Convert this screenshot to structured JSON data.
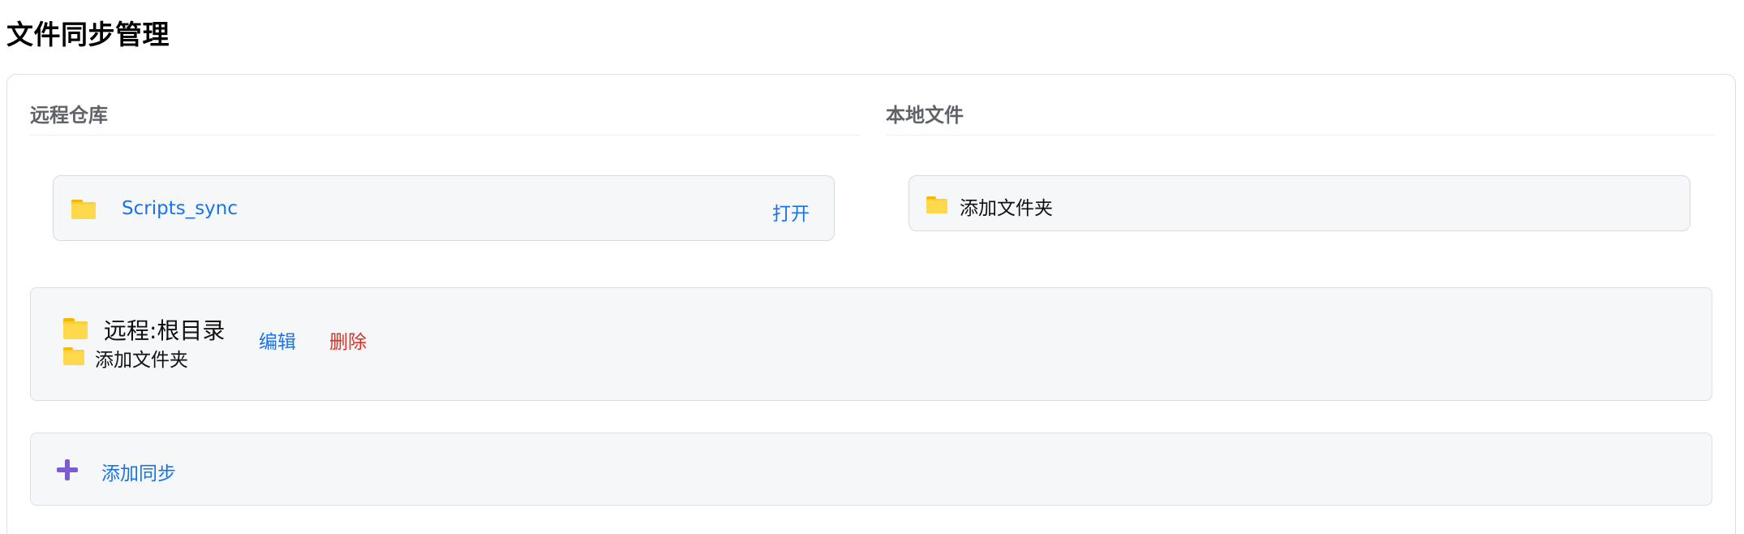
{
  "page": {
    "title": "文件同步管理"
  },
  "remote": {
    "heading": "远程仓库",
    "repo_name": "Scripts_sync",
    "open_label": "打开"
  },
  "local": {
    "heading": "本地文件",
    "add_folder_label": "添加文件夹"
  },
  "sync_item": {
    "path_label": "远程:根目录",
    "edit_label": "编辑",
    "delete_label": "删除",
    "add_folder_label": "添加文件夹"
  },
  "add_sync": {
    "label": "添加同步"
  },
  "icons": {
    "folder": "folder-icon",
    "plus": "plus-icon"
  },
  "colors": {
    "link": "#1a73e8",
    "danger": "#d93025",
    "folder": "#ffcf33",
    "plus": "#7b5cd6"
  }
}
